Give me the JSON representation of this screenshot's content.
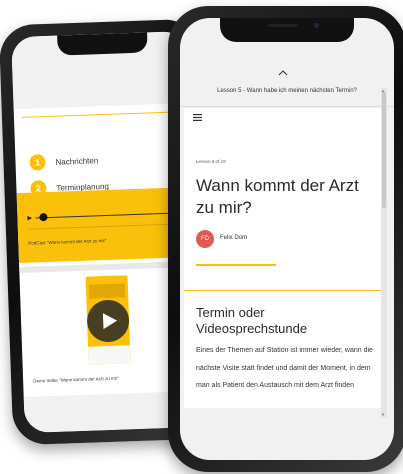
{
  "back_phone": {
    "nav_items": [
      {
        "number": "1",
        "label": "Nachrichten"
      },
      {
        "number": "2",
        "label": "Terminplanung"
      }
    ],
    "podcast_caption": "PodCast \"Wann kommt der Arzt zu mir\"",
    "video_caption": "Demo Video \"Wann kommt der Arzt zu mir\""
  },
  "front_phone": {
    "lesson_header": "Lesson 5 - Wann habe ich meinen nächsten Termin?",
    "lesson_count": "Lesson 6 of 19",
    "title": "Wann kommt der Arzt zu mir?",
    "author": {
      "initials": "FD",
      "name": "Felix Dorn"
    },
    "section_title": "Termin oder Videosprechstunde",
    "body_text": "Eines der Themen auf Station ist immer wieder, wann die nächste Visite statt findet und damit der Moment, in dem man als Patient den Austausch mit dem Arzt finden"
  },
  "colors": {
    "accent": "#fbc10a",
    "avatar": "#e05a52",
    "text": "#2b2b2b"
  }
}
